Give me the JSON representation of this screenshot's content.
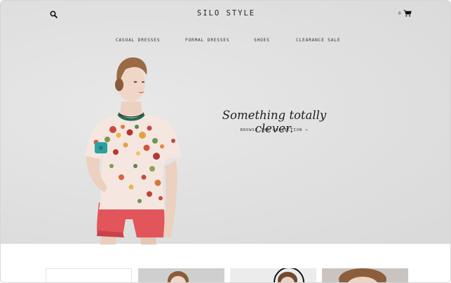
{
  "header": {
    "brand": "SILO STYLE",
    "search_icon": "search-icon",
    "cart_icon": "cart-icon",
    "cart_count": "0"
  },
  "nav": {
    "items": [
      {
        "label": "CASUAL DRESSES"
      },
      {
        "label": "FORMAL DRESSES"
      },
      {
        "label": "SHOES"
      },
      {
        "label": "CLEARANCE SALE"
      }
    ]
  },
  "hero": {
    "headline": "Something totally clever.",
    "cta": "BROWSE THE COLLECTION →"
  },
  "colors": {
    "hero_background": "#e0e0e0",
    "shorts": "#e2555b",
    "text": "#222222"
  }
}
